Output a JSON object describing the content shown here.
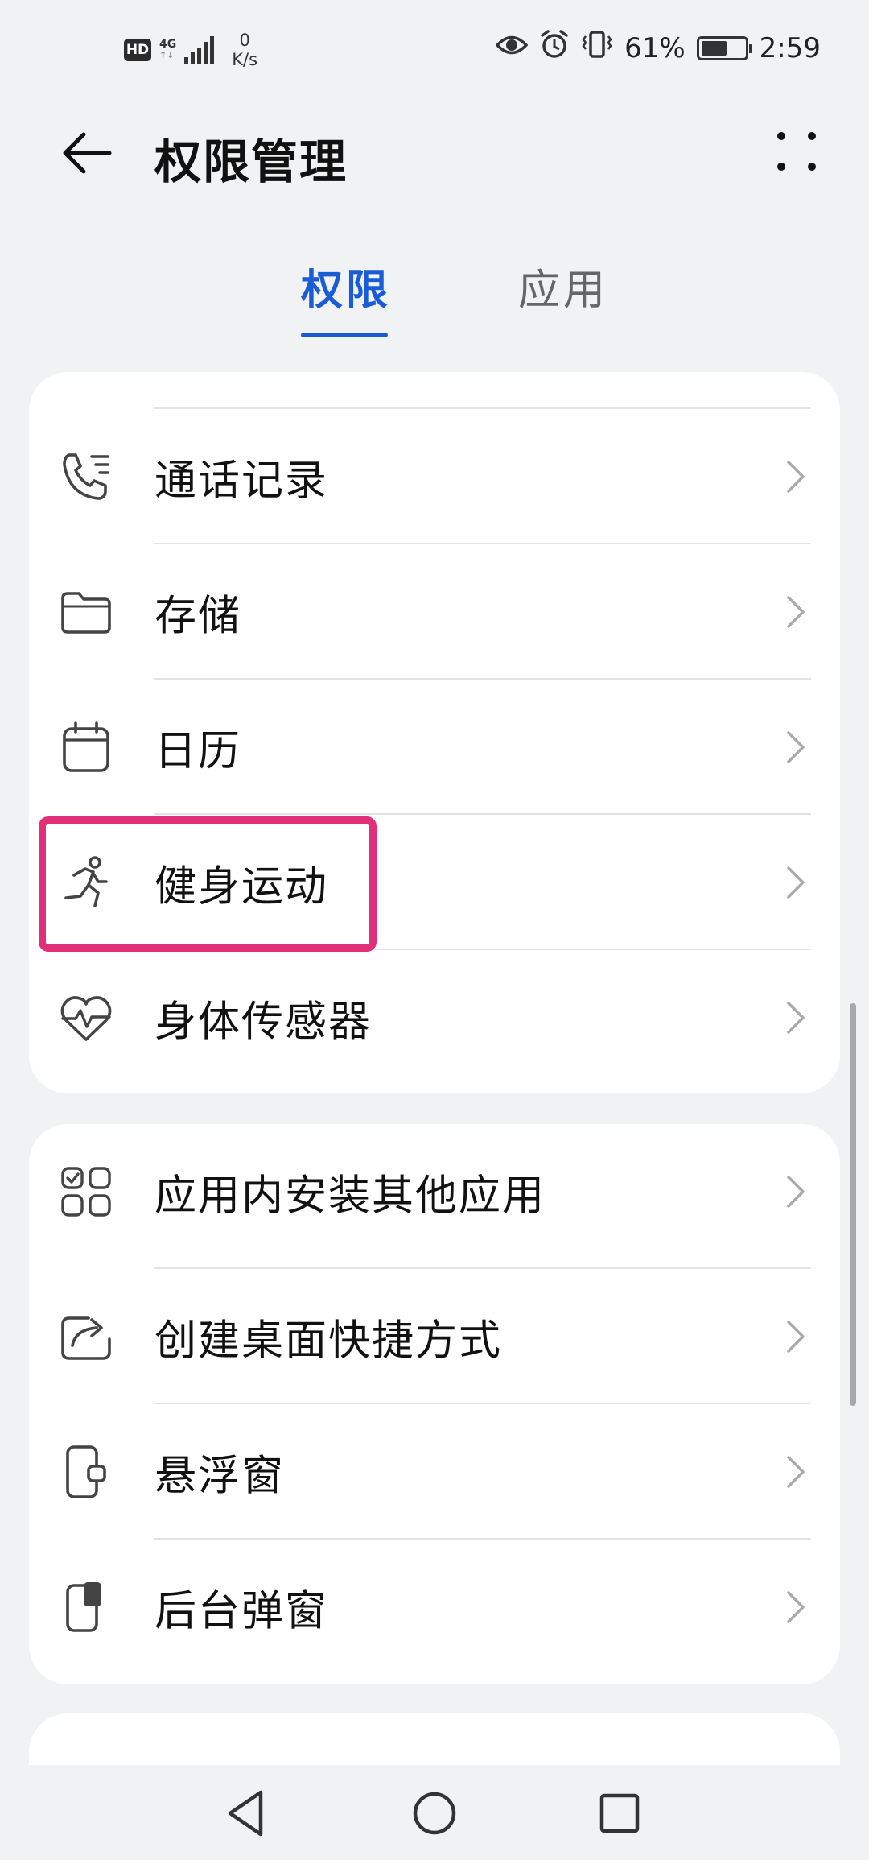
{
  "status_bar": {
    "hd": "HD",
    "network": "4G",
    "network_sub": "↑↓",
    "netspeed_value": "0",
    "netspeed_unit": "K/s",
    "battery_percent": "61%",
    "battery_level": 0.61,
    "time": "2:59",
    "icons": [
      "eye-icon",
      "alarm-icon",
      "vibrate-icon"
    ]
  },
  "header": {
    "title": "权限管理",
    "back_icon": "arrow-left-icon",
    "more_icon": "more-dots-icon"
  },
  "tabs": [
    {
      "label": "权限",
      "active": true
    },
    {
      "label": "应用",
      "active": false
    }
  ],
  "colors": {
    "accent": "#1a5bd6",
    "highlight": "#e0307a",
    "background": "#f1f2f4",
    "card": "#ffffff"
  },
  "permissions_group": [
    {
      "label": "通话记录",
      "icon": "call-log-icon"
    },
    {
      "label": "存储",
      "icon": "folder-icon"
    },
    {
      "label": "日历",
      "icon": "calendar-icon"
    },
    {
      "label": "健身运动",
      "icon": "running-icon",
      "highlighted": true
    },
    {
      "label": "身体传感器",
      "icon": "heart-rate-icon"
    }
  ],
  "special_group": [
    {
      "label": "应用内安装其他应用",
      "icon": "app-grid-icon"
    },
    {
      "label": "创建桌面快捷方式",
      "icon": "share-shortcut-icon"
    },
    {
      "label": "悬浮窗",
      "icon": "floating-window-icon"
    },
    {
      "label": "后台弹窗",
      "icon": "background-popup-icon"
    }
  ],
  "nav_bar": {
    "back": "nav-back-icon",
    "home": "nav-home-icon",
    "recent": "nav-recent-icon"
  }
}
